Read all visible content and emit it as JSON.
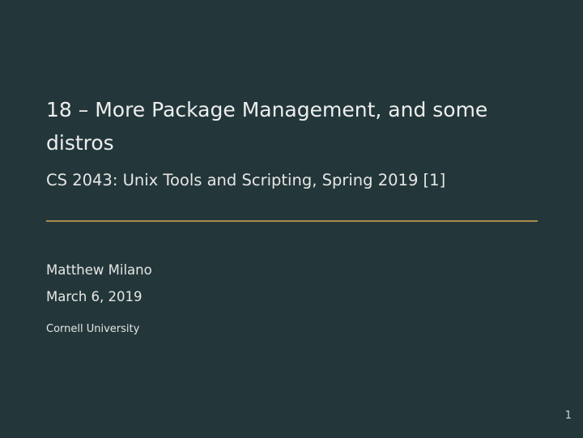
{
  "slide": {
    "title": "18 – More Package Management, and some distros",
    "subtitle": "CS 2043: Unix Tools and Scripting, Spring 2019 [1]",
    "author": "Matthew Milano",
    "date": "March 6, 2019",
    "institute": "Cornell University",
    "page_number": "1"
  },
  "colors": {
    "background": "#23373b",
    "accent_rule": "#a88a4d",
    "text": "#eeeeec"
  }
}
